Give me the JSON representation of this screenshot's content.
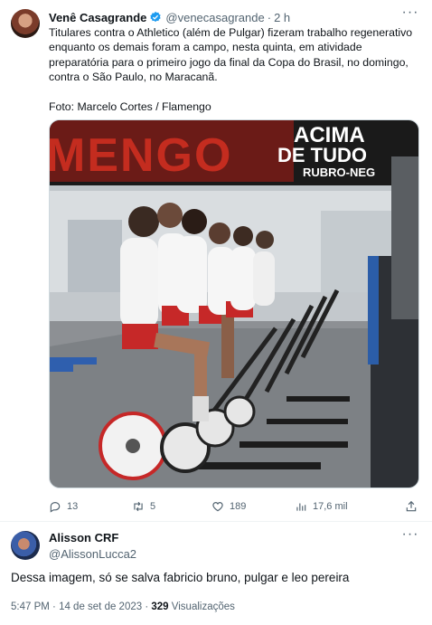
{
  "tweet": {
    "author_name": "Venê Casagrande",
    "handle": "@venecasagrande",
    "separator": "·",
    "time": "2 h",
    "text": "Titulares contra o Athletico (além de Pulgar) fizeram trabalho regenerativo enquanto os demais foram a campo, nesta quinta, em atividade preparatória para o primeiro jogo da final da Copa do Brasil, no domingo, contra o São Paulo, no Maracanã.\n\nFoto: Marcelo Cortes / Flamengo",
    "photo": {
      "banner_left": "MENGO",
      "banner_right_1": "ACIMA",
      "banner_right_2": "DE TUDO",
      "banner_right_3": "RUBRO-NEG"
    },
    "actions": {
      "replies": "13",
      "retweets": "5",
      "likes": "189",
      "views": "17,6 mil"
    }
  },
  "reply": {
    "author_name": "Alisson CRF",
    "handle": "@AlissonLucca2",
    "text": "Dessa imagem, só se salva fabricio bruno, pulgar e leo pereira",
    "time": "5:47 PM",
    "date": "14 de set de 2023",
    "views_count": "329",
    "views_label": "Visualizações"
  },
  "colors": {
    "text": "#0f1419",
    "secondary": "#536471",
    "verified": "#1d9bf0",
    "divider": "#eff3f4"
  },
  "icons": [
    "more-icon",
    "verified-icon",
    "reply-icon",
    "retweet-icon",
    "like-icon",
    "views-icon",
    "share-icon"
  ]
}
